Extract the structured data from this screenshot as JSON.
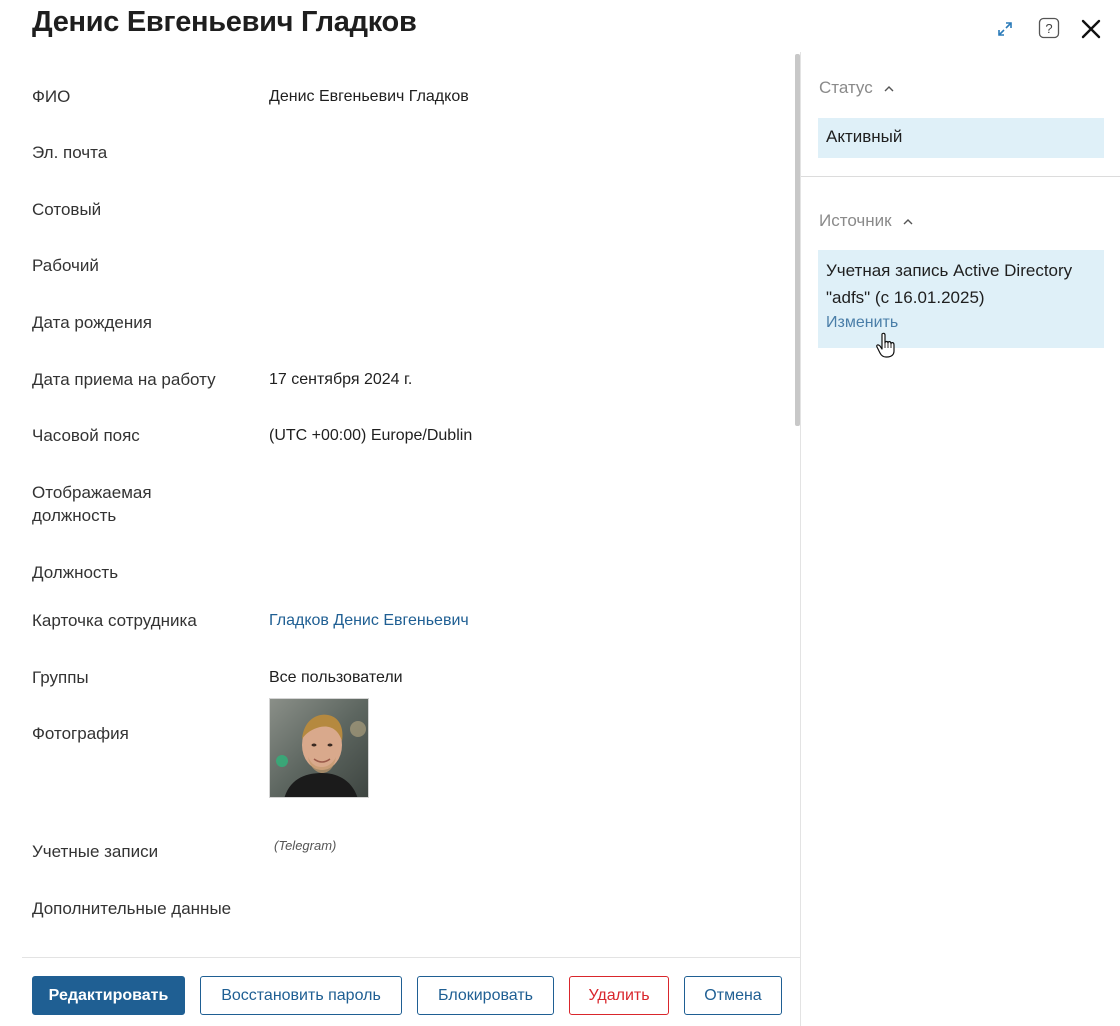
{
  "header": {
    "title": "Денис Евгеньевич Гладков",
    "icons": [
      "expand-icon",
      "help-icon",
      "close-icon"
    ]
  },
  "fields": [
    {
      "label": "ФИО",
      "value": "Денис Евгеньевич Гладков"
    },
    {
      "label": "Эл. почта",
      "value": ""
    },
    {
      "label": "Сотовый",
      "value": ""
    },
    {
      "label": "Рабочий",
      "value": ""
    },
    {
      "label": "Дата рождения",
      "value": ""
    },
    {
      "label": "Дата приема на работу",
      "value": "17 сентября 2024 г."
    },
    {
      "label": "Часовой пояс",
      "value": "(UTC +00:00) Europe/Dublin"
    },
    {
      "label": "Отображаемая должность",
      "value": ""
    },
    {
      "label": "Должность",
      "value": ""
    },
    {
      "label": "Карточка сотрудника",
      "value": "Гладков Денис Евгеньевич"
    },
    {
      "label": "Группы",
      "value": "Все пользователи"
    },
    {
      "label": "Фотография",
      "value": ""
    },
    {
      "label": "Учетные записи",
      "value": "(Telegram)"
    },
    {
      "label": "Дополнительные данные",
      "value": ""
    }
  ],
  "sidebar": {
    "status": {
      "heading": "Статус",
      "value": "Активный"
    },
    "source": {
      "heading": "Источник",
      "value": "Учетная запись Active Directory \"adfs\" (с 16.01.2025)",
      "action": "Изменить"
    }
  },
  "footer": {
    "edit": "Редактировать",
    "reset_password": "Восстановить пароль",
    "block": "Блокировать",
    "delete": "Удалить",
    "cancel": "Отмена"
  },
  "colors": {
    "primary": "#1f5f93",
    "link": "#1f5f93",
    "danger": "#d9262c",
    "highlight_bg": "#dff0f8"
  }
}
